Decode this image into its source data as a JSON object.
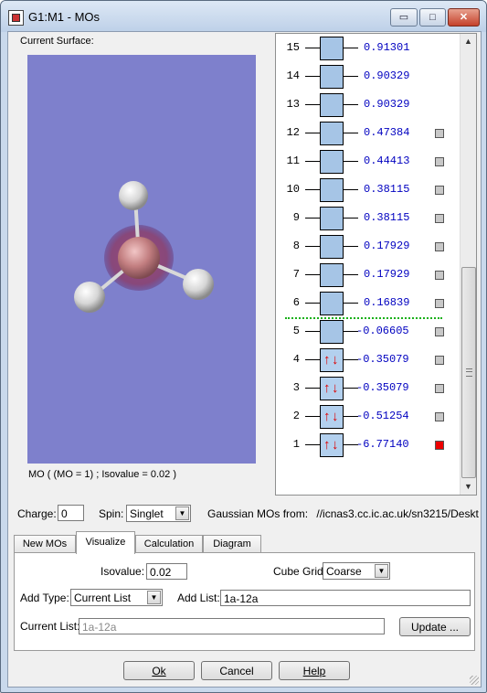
{
  "window": {
    "title": "G1:M1 - MOs",
    "buttons": {
      "minimize": "▭",
      "maximize": "□",
      "close": "✕"
    }
  },
  "surface": {
    "label": "Current Surface:",
    "caption": "MO ( (MO = 1) ; Isovalue = 0.02 )"
  },
  "mo_list": [
    {
      "num": "15",
      "energy": "0.91301",
      "occupied": false,
      "flag": "none"
    },
    {
      "num": "14",
      "energy": "0.90329",
      "occupied": false,
      "flag": "none"
    },
    {
      "num": "13",
      "energy": "0.90329",
      "occupied": false,
      "flag": "none"
    },
    {
      "num": "12",
      "energy": "0.47384",
      "occupied": false,
      "flag": "gray"
    },
    {
      "num": "11",
      "energy": "0.44413",
      "occupied": false,
      "flag": "gray"
    },
    {
      "num": "10",
      "energy": "0.38115",
      "occupied": false,
      "flag": "gray"
    },
    {
      "num": "9",
      "energy": "0.38115",
      "occupied": false,
      "flag": "gray"
    },
    {
      "num": "8",
      "energy": "0.17929",
      "occupied": false,
      "flag": "gray"
    },
    {
      "num": "7",
      "energy": "0.17929",
      "occupied": false,
      "flag": "gray"
    },
    {
      "num": "6",
      "energy": "0.16839",
      "occupied": false,
      "flag": "gray"
    },
    {
      "num": "5",
      "energy": "-0.06605",
      "occupied": false,
      "flag": "gray"
    },
    {
      "num": "4",
      "energy": "-0.35079",
      "occupied": true,
      "flag": "gray"
    },
    {
      "num": "3",
      "energy": "-0.35079",
      "occupied": true,
      "flag": "gray"
    },
    {
      "num": "2",
      "energy": "-0.51254",
      "occupied": true,
      "flag": "gray"
    },
    {
      "num": "1",
      "energy": "-6.77140",
      "occupied": true,
      "flag": "red"
    }
  ],
  "charge": {
    "label": "Charge:",
    "value": "0"
  },
  "spin": {
    "label": "Spin:",
    "value": "Singlet"
  },
  "source": {
    "label": "Gaussian MOs from:",
    "path": "//icnas3.cc.ic.ac.uk/sn3215/Deskt"
  },
  "tabs": [
    {
      "label": "New MOs",
      "active": false
    },
    {
      "label": "Visualize",
      "active": true
    },
    {
      "label": "Calculation",
      "active": false
    },
    {
      "label": "Diagram",
      "active": false
    }
  ],
  "visualize": {
    "isovalue_label": "Isovalue:",
    "isovalue": "0.02",
    "cube_grid_label": "Cube Grid:",
    "cube_grid": "Coarse",
    "add_type_label": "Add Type:",
    "add_type": "Current List",
    "add_list_label": "Add List:",
    "add_list": "1a-12a",
    "current_list_label": "Current List:",
    "current_list": "1a-12a",
    "update_label": "Update ..."
  },
  "footer": {
    "ok": "Ok",
    "cancel": "Cancel",
    "help": "Help"
  },
  "colors": {
    "viewport_bg": "#7e80cc",
    "energy_text": "#0000c0",
    "homo_lumo_line": "#18b018",
    "electron_arrow": "#dd0000",
    "selected_flag": "#ee0000"
  }
}
